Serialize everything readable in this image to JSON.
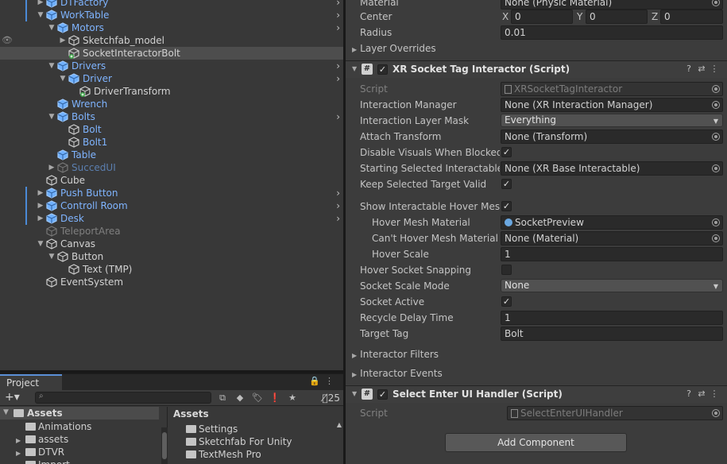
{
  "hierarchy": {
    "items": [
      {
        "label": "DTFactory",
        "style": "blue",
        "indent": 1,
        "fold": "closed",
        "icon": "prefab"
      },
      {
        "label": "WorkTable",
        "style": "blue",
        "indent": 1,
        "fold": "open",
        "icon": "prefab"
      },
      {
        "label": "Motors",
        "style": "blue",
        "indent": 2,
        "fold": "open",
        "icon": "prefab"
      },
      {
        "label": "Sketchfab_model",
        "style": "white",
        "indent": 3,
        "fold": "closed",
        "icon": "gameobject"
      },
      {
        "label": "SocketInteractorBolt",
        "style": "white",
        "indent": 3,
        "fold": "none",
        "icon": "gameobject-added"
      },
      {
        "label": "Drivers",
        "style": "blue",
        "indent": 2,
        "fold": "open",
        "icon": "prefab"
      },
      {
        "label": "Driver",
        "style": "blue",
        "indent": 3,
        "fold": "open",
        "icon": "prefab"
      },
      {
        "label": "DriverTransform",
        "style": "white",
        "indent": 4,
        "fold": "none",
        "icon": "gameobject-added"
      },
      {
        "label": "Wrench",
        "style": "blue",
        "indent": 2,
        "fold": "none",
        "icon": "prefab"
      },
      {
        "label": "Bolts",
        "style": "blue",
        "indent": 2,
        "fold": "open",
        "icon": "prefab"
      },
      {
        "label": "Bolt",
        "style": "blue",
        "indent": 3,
        "fold": "none",
        "icon": "gameobject"
      },
      {
        "label": "Bolt1",
        "style": "blue",
        "indent": 3,
        "fold": "none",
        "icon": "gameobject"
      },
      {
        "label": "Table",
        "style": "blue",
        "indent": 2,
        "fold": "none",
        "icon": "prefab"
      },
      {
        "label": "SuccedUI",
        "style": "dimblue",
        "indent": 2,
        "fold": "closed",
        "icon": "gameobject-dim"
      },
      {
        "label": "Cube",
        "style": "white",
        "indent": 1,
        "fold": "none",
        "icon": "gameobject"
      },
      {
        "label": "Push Button",
        "style": "blue",
        "indent": 1,
        "fold": "closed",
        "icon": "prefab"
      },
      {
        "label": "Controll Room",
        "style": "blue",
        "indent": 1,
        "fold": "closed",
        "icon": "prefab"
      },
      {
        "label": "Desk",
        "style": "blue",
        "indent": 1,
        "fold": "closed",
        "icon": "prefab"
      },
      {
        "label": "TeleportArea",
        "style": "dim",
        "indent": 1,
        "fold": "none",
        "icon": "gameobject-dim"
      },
      {
        "label": "Canvas",
        "style": "white",
        "indent": 1,
        "fold": "open",
        "icon": "gameobject"
      },
      {
        "label": "Button",
        "style": "white",
        "indent": 2,
        "fold": "open",
        "icon": "gameobject"
      },
      {
        "label": "Text (TMP)",
        "style": "white",
        "indent": 3,
        "fold": "none",
        "icon": "gameobject"
      },
      {
        "label": "EventSystem",
        "style": "white",
        "indent": 1,
        "fold": "none",
        "icon": "gameobject"
      }
    ]
  },
  "project": {
    "tab_label": "Project",
    "hidden_count": "25",
    "tree_root": "Assets",
    "tree_items": [
      "Animations",
      "assets",
      "DTVR",
      "Import"
    ],
    "right_header": "Assets",
    "right_items": [
      "Settings",
      "Sketchfab For Unity",
      "TextMesh Pro"
    ]
  },
  "inspector": {
    "top_rows": {
      "material_label": "Material",
      "material_value": "None (Physic Material)",
      "center_label": "Center",
      "center_x": "0",
      "center_y": "0",
      "center_z": "0",
      "radius_label": "Radius",
      "radius_value": "0.01",
      "layer_overrides": "Layer Overrides"
    },
    "axis": {
      "x": "X",
      "y": "Y",
      "z": "Z"
    },
    "socket_component": {
      "title": "XR Socket Tag Interactor (Script)",
      "script_label": "Script",
      "script_value": "XRSocketTagInteractor",
      "interaction_manager_label": "Interaction Manager",
      "interaction_manager_value": "None (XR Interaction Manager)",
      "layer_mask_label": "Interaction Layer Mask",
      "layer_mask_value": "Everything",
      "attach_transform_label": "Attach Transform",
      "attach_transform_value": "None (Transform)",
      "disable_visuals_label": "Disable Visuals When Blocked In Group",
      "starting_selected_label": "Starting Selected Interactable",
      "starting_selected_value": "None (XR Base Interactable)",
      "keep_selected_label": "Keep Selected Target Valid",
      "show_hover_mesh_label": "Show Interactable Hover Meshes",
      "hover_mesh_material_label": "Hover Mesh Material",
      "hover_mesh_material_value": "SocketPreview",
      "cant_hover_material_label": "Can't Hover Mesh Material",
      "cant_hover_material_value": "None (Material)",
      "hover_scale_label": "Hover Scale",
      "hover_scale_value": "1",
      "hover_snapping_label": "Hover Socket Snapping",
      "socket_scale_mode_label": "Socket Scale Mode",
      "socket_scale_mode_value": "None",
      "socket_active_label": "Socket Active",
      "recycle_delay_label": "Recycle Delay Time",
      "recycle_delay_value": "1",
      "target_tag_label": "Target Tag",
      "target_tag_value": "Bolt",
      "interactor_filters": "Interactor Filters",
      "interactor_events": "Interactor Events"
    },
    "ui_handler_component": {
      "title": "Select Enter UI Handler (Script)",
      "script_label": "Script",
      "script_value": "SelectEnterUIHandler"
    },
    "add_component_label": "Add Component",
    "checkmark": "✓"
  }
}
